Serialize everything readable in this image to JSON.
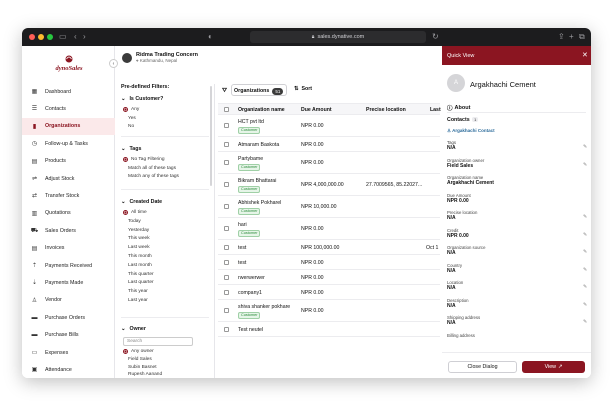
{
  "browser": {
    "url": "sales.dynative.com"
  },
  "app": {
    "brand": "dynoSales",
    "company_name": "Ridma Trading Concern",
    "company_location": "Kathmandu, Nepal",
    "collapse_icon": "chevron-left-icon"
  },
  "sidebar": {
    "items": [
      {
        "label": "Dashboard",
        "icon": "dashboard-icon"
      },
      {
        "label": "Contacts",
        "icon": "contacts-icon"
      },
      {
        "label": "Organizations",
        "icon": "organizations-icon",
        "active": true
      },
      {
        "label": "Follow-up & Tasks",
        "icon": "clock-icon"
      },
      {
        "label": "Products",
        "icon": "box-icon"
      },
      {
        "label": "Adjust Stock",
        "icon": "adjust-icon"
      },
      {
        "label": "Transfer Stock",
        "icon": "transfer-icon"
      },
      {
        "label": "Quotations",
        "icon": "quotation-icon"
      },
      {
        "label": "Sales Orders",
        "icon": "cart-icon"
      },
      {
        "label": "Invoices",
        "icon": "invoice-icon"
      },
      {
        "label": "Payments Received",
        "icon": "payment-in-icon"
      },
      {
        "label": "Payments Made",
        "icon": "payment-out-icon"
      },
      {
        "label": "Vendor",
        "icon": "vendor-icon"
      },
      {
        "label": "Purchase Orders",
        "icon": "purchase-order-icon"
      },
      {
        "label": "Purchase Bills",
        "icon": "bill-icon"
      },
      {
        "label": "Expenses",
        "icon": "expense-icon"
      },
      {
        "label": "Attendance",
        "icon": "calendar-icon"
      }
    ]
  },
  "filters": {
    "title": "Pre-defined Filters:",
    "is_customer": {
      "title": "Is Customer?",
      "options": [
        "Any",
        "Yes",
        "No"
      ],
      "selected": "Any"
    },
    "tags": {
      "title": "Tags",
      "options": [
        "No Tag Filtering",
        "Match all of these tags",
        "Match any of these tags"
      ],
      "selected": "No Tag Filtering"
    },
    "created_date": {
      "title": "Created Date",
      "options": [
        "All time",
        "Today",
        "Yesterday",
        "This week",
        "Last week",
        "This month",
        "Last month",
        "This quarter",
        "Last quarter",
        "This year",
        "Last year"
      ],
      "selected": "All time"
    },
    "owner": {
      "title": "Owner",
      "search_placeholder": "Search",
      "options": [
        "Any owner",
        "Field Sales",
        "Subin Basnet",
        "Rupesh Aanand"
      ],
      "selected": "Any owner"
    }
  },
  "table": {
    "tab_label": "Organizations",
    "tab_count": "51",
    "sort_label": "Sort",
    "columns": [
      "Organization name",
      "Due Amount",
      "Precise location",
      "Last"
    ],
    "rows": [
      {
        "name": "HCT pvt ltd",
        "tag": "Customer",
        "due": "NPR 0.00",
        "location": "",
        "last": ""
      },
      {
        "name": "Atmaram Baskota",
        "tag": "",
        "due": "NPR 0.00",
        "location": "",
        "last": ""
      },
      {
        "name": "Partybame",
        "tag": "Customer",
        "due": "NPR 0.00",
        "location": "",
        "last": ""
      },
      {
        "name": "Bikram Bhattarai",
        "tag": "Customer",
        "due": "NPR 4,000,000.00",
        "location": "27.7009565, 85.22027...",
        "last": ""
      },
      {
        "name": "Abhishek Pokharel",
        "tag": "Customer",
        "due": "NPR 10,000.00",
        "location": "",
        "last": ""
      },
      {
        "name": "hari",
        "tag": "Customer",
        "due": "NPR 0.00",
        "location": "",
        "last": ""
      },
      {
        "name": "test",
        "tag": "",
        "due": "NPR 100,000.00",
        "location": "",
        "last": "Oct 1"
      },
      {
        "name": "test",
        "tag": "",
        "due": "NPR 0.00",
        "location": "",
        "last": ""
      },
      {
        "name": "rwerwerwer",
        "tag": "",
        "due": "NPR 0.00",
        "location": "",
        "last": ""
      },
      {
        "name": "company1",
        "tag": "",
        "due": "NPR 0.00",
        "location": "",
        "last": ""
      },
      {
        "name": "shiva shanker pokhare",
        "tag": "Customer",
        "due": "NPR 0.00",
        "location": "",
        "last": ""
      },
      {
        "name": "Test neutel",
        "tag": "",
        "due": "",
        "location": "",
        "last": ""
      }
    ]
  },
  "quick_view": {
    "title": "Quick View",
    "avatar_letter": "A",
    "org_name": "Argakhachi Cement",
    "about_label": "About",
    "contacts_label": "Contacts",
    "contacts_count": "1",
    "contact_name": "Argakhachi Contact",
    "fields": [
      {
        "label": "Tags",
        "value": "N/A"
      },
      {
        "label": "Organization owner",
        "value": "Field Sales"
      },
      {
        "label": "Organization name",
        "value": "Argakhachi Cement"
      },
      {
        "label": "Due Amount",
        "value": "NPR 0.00"
      },
      {
        "label": "Precise location",
        "value": "N/A"
      },
      {
        "label": "Credit",
        "value": "NPR 0.00"
      },
      {
        "label": "Organization source",
        "value": "N/A"
      },
      {
        "label": "Country",
        "value": "N/A"
      },
      {
        "label": "Location",
        "value": "N/A"
      },
      {
        "label": "Description",
        "value": "N/A"
      },
      {
        "label": "Shipping address",
        "value": "N/A"
      },
      {
        "label": "Billing address",
        "value": ""
      }
    ],
    "close_button": "Close Dialog",
    "view_button": "View"
  },
  "colors": {
    "brand": "#8b1521",
    "titlebar": "#1c1c1e",
    "customer_tag": "#2a8a3a"
  }
}
